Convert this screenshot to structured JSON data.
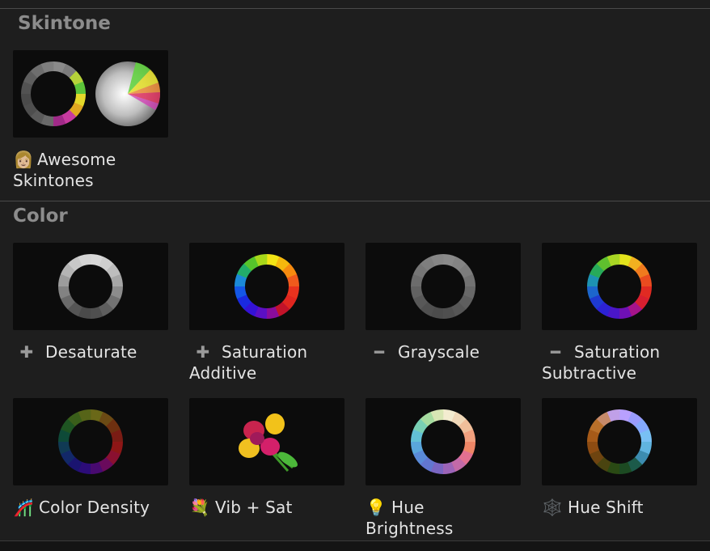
{
  "sections": {
    "skintone": {
      "title": "Skintone",
      "items": [
        {
          "icon": "woman-face-icon",
          "glyph": "👩🏼",
          "line1": "Awesome",
          "line2": "Skintones"
        }
      ]
    },
    "color": {
      "title": "Color",
      "items": [
        {
          "icon": "plus-icon",
          "glyph": "➕",
          "line1": "Desaturate",
          "line2": ""
        },
        {
          "icon": "plus-icon",
          "glyph": "➕",
          "line1": "Saturation",
          "line2": "Additive"
        },
        {
          "icon": "minus-icon",
          "glyph": "➖",
          "line1": "Grayscale",
          "line2": ""
        },
        {
          "icon": "minus-icon",
          "glyph": "➖",
          "line1": "Saturation",
          "line2": "Subtractive"
        },
        {
          "icon": "roller-coaster-icon",
          "glyph": "🎢",
          "line1": "Color Density",
          "line2": ""
        },
        {
          "icon": "bouquet-icon",
          "glyph": "💐",
          "line1": "Vib + Sat",
          "line2": ""
        },
        {
          "icon": "light-bulb-icon",
          "glyph": "💡",
          "line1": "Hue",
          "line2": "Brightness"
        },
        {
          "icon": "spider-web-icon",
          "glyph": "🕸️",
          "line1": "Hue Shift",
          "line2": ""
        }
      ]
    }
  },
  "wheel_colors": {
    "desaturate": [
      "#d8d8d8",
      "#cfcfcf",
      "#bdbdbd",
      "#a6a6a6",
      "#8c8c8c",
      "#727272",
      "#5e5e5e",
      "#4f4f4f",
      "#4a4a4a",
      "#555555",
      "#6a6a6a",
      "#828282",
      "#9c9c9c",
      "#b4b4b4",
      "#c8c8c8",
      "#d4d4d4"
    ],
    "saturation_additive": [
      "#f2e415",
      "#f5b80d",
      "#f68a0f",
      "#f05a1c",
      "#e8321e",
      "#e0261f",
      "#c2132a",
      "#8a0c9c",
      "#5b0fc4",
      "#3412d6",
      "#1a2ae0",
      "#1457e6",
      "#1b8ad8",
      "#22ad6a",
      "#56c42b",
      "#a8d81a"
    ],
    "grayscale": [
      "#8a8a8a",
      "#848484",
      "#7c7c7c",
      "#727272",
      "#686868",
      "#5e5e5e",
      "#565656",
      "#4f4f4f",
      "#4c4c4c",
      "#505050",
      "#585858",
      "#626262",
      "#6c6c6c",
      "#767676",
      "#7e7e7e",
      "#868686"
    ],
    "saturation_subtractive": [
      "#e3e31c",
      "#f2b020",
      "#f07a1e",
      "#ea4b1f",
      "#e02a22",
      "#d81f30",
      "#a5148a",
      "#6f10b4",
      "#4a16c8",
      "#2c22d4",
      "#1e3ad0",
      "#1c66cc",
      "#1d92b2",
      "#27aa5a",
      "#5fc02e",
      "#a8d624"
    ],
    "color_density": [
      "#6a6818",
      "#6b4a14",
      "#6e3010",
      "#7a1c14",
      "#8e1616",
      "#8a1030",
      "#6a0a5c",
      "#480a70",
      "#2c0c78",
      "#1a1470",
      "#122868",
      "#103a54",
      "#0e4a38",
      "#1e5422",
      "#3a5e1a",
      "#566418"
    ],
    "hue_brightness": [
      "#f3ecd0",
      "#f0d8b8",
      "#f0be9a",
      "#f2a07e",
      "#ee8666",
      "#e27090",
      "#c26aa8",
      "#9c64b8",
      "#7a66c2",
      "#6276d0",
      "#5a8ad8",
      "#5aa6dc",
      "#62c0d6",
      "#78d0b4",
      "#a6dca0",
      "#d8e6b4"
    ],
    "hue_shift": [
      "#b8a0ff",
      "#9a9cff",
      "#84aaff",
      "#78c0f4",
      "#60b4e0",
      "#3c8cb0",
      "#1c5a4a",
      "#1c4a22",
      "#2a4a14",
      "#4a4410",
      "#6e4410",
      "#8e4c12",
      "#a65a18",
      "#b8702a",
      "#c68a6a",
      "#c0a0e8"
    ]
  }
}
